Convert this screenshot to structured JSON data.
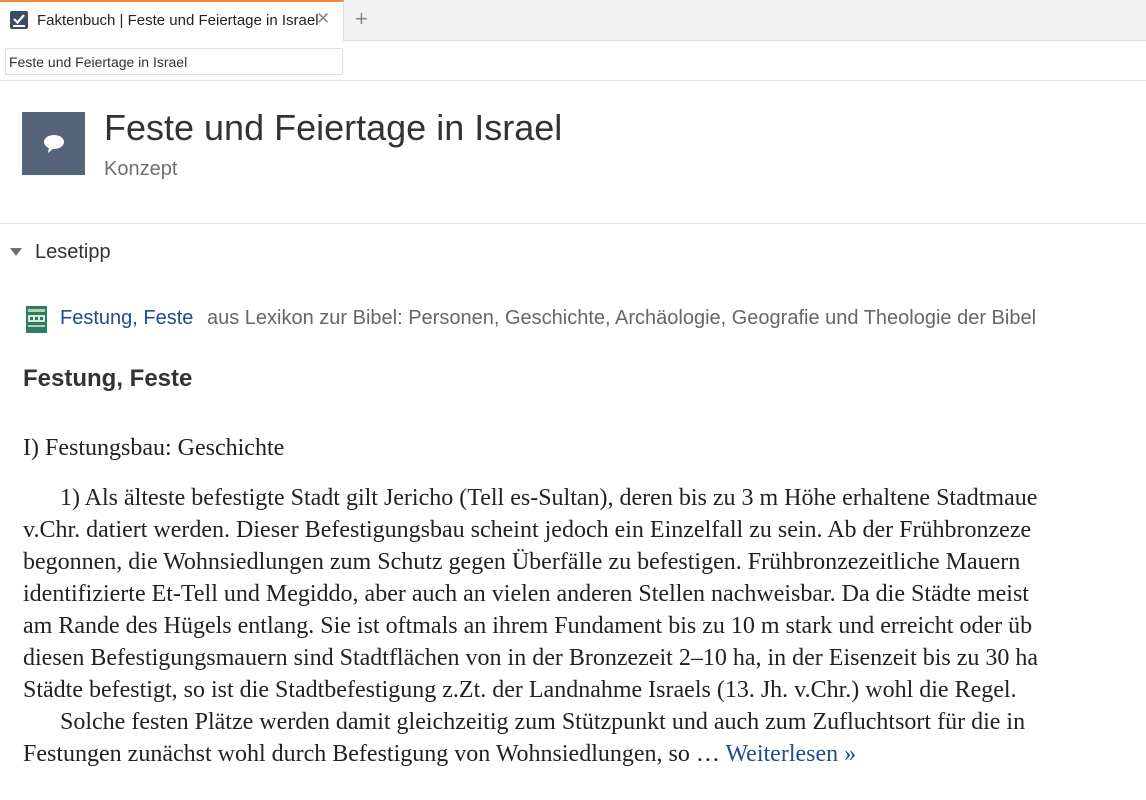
{
  "tab": {
    "title": "Faktenbuch | Feste und Feiertage in Israel",
    "close_glyph": "✕",
    "add_glyph": "+"
  },
  "address": {
    "value": "Feste und Feiertage in Israel"
  },
  "header": {
    "title": "Feste und Feiertage in Israel",
    "subtitle": "Konzept",
    "icon": "speech-bubble-icon",
    "tile_color": "#56647a"
  },
  "section": {
    "title": "Lesetipp"
  },
  "source": {
    "link": "Festung, Feste",
    "text": "aus Lexikon zur Bibel: Personen, Geschichte, Archäologie, Geografie und Theologie der Bibel"
  },
  "article": {
    "heading": "Festung, Feste",
    "subheading": "I) Festungsbau: Geschichte",
    "lines": [
      "1) Als älteste befestigte Stadt gilt Jericho (Tell es-Sultan), deren bis zu 3 m Höhe erhaltene Stadtmaue",
      "v.Chr. datiert werden. Dieser Befestigungsbau scheint jedoch ein Einzelfall zu sein. Ab der Frühbronzeze",
      "begonnen, die Wohnsiedlungen zum Schutz gegen Überfälle zu befestigen. Frühbronzezeitliche Mauern",
      "identifizierte Et-Tell und Megiddo, aber auch an vielen anderen Stellen nachweisbar. Da die Städte meist",
      "am Rande des Hügels entlang. Sie ist oftmals an ihrem Fundament bis zu 10 m stark und erreicht oder üb",
      "diesen Befestigungsmauern sind Stadtflächen von in der Bronzezeit 2–10 ha, in der Eisenzeit bis zu 30 ha",
      "Städte befestigt, so ist die Stadtbefestigung z.Zt. der Landnahme Israels (13. Jh. v.Chr.) wohl die Regel.",
      "Solche festen Plätze werden damit gleichzeitig zum Stützpunkt und auch zum Zufluchtsort für die in",
      "Festungen zunächst wohl durch Befestigung von Wohnsiedlungen, so …"
    ],
    "more_link": "Weiterlesen »"
  },
  "colors": {
    "accent_tab": "#f08a3c",
    "link": "#1f4c8f"
  }
}
